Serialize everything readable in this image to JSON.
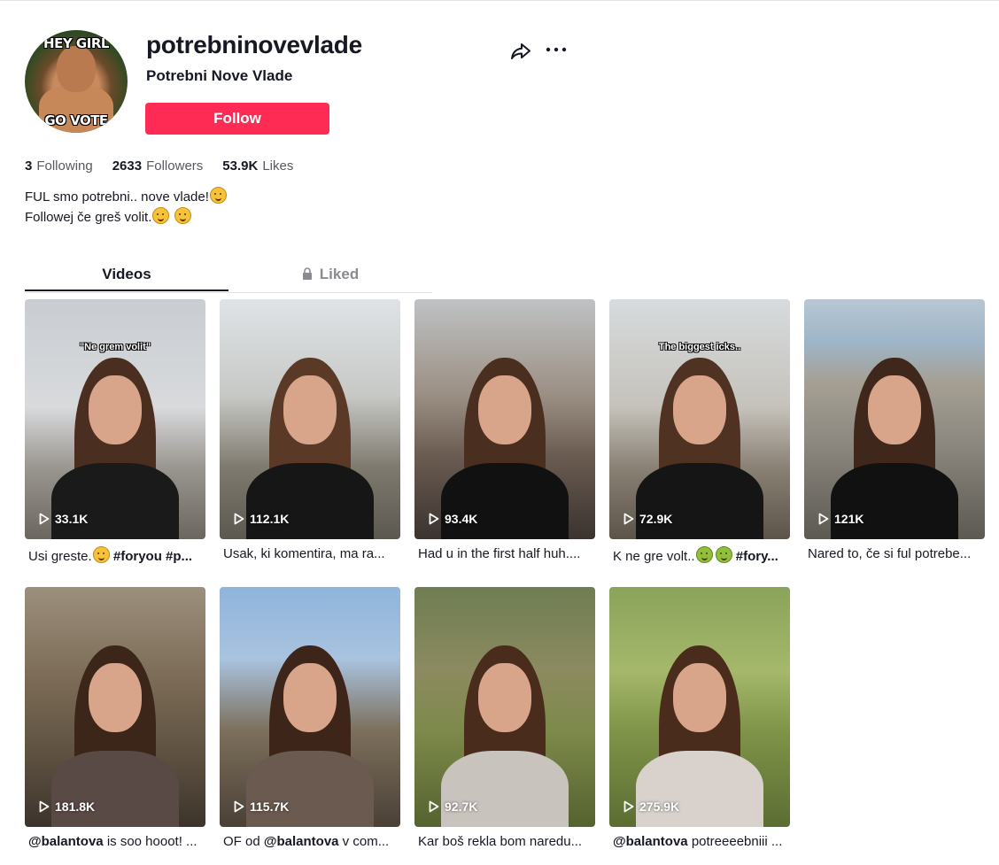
{
  "profile": {
    "avatar_text_top": "HEY GIRL",
    "avatar_text_bottom": "GO VOTE",
    "username": "potrebninovevlade",
    "display_name": "Potrebni Nove Vlade",
    "follow_label": "Follow",
    "stats": {
      "following_count": "3",
      "following_label": "Following",
      "followers_count": "2633",
      "followers_label": "Followers",
      "likes_count": "53.9K",
      "likes_label": "Likes"
    },
    "bio_line1": "FUL smo potrebni.. nove vlade!",
    "bio_line2": "Followej če greš volit."
  },
  "tabs": {
    "videos": "Videos",
    "liked": "Liked"
  },
  "colors": {
    "brand": "#fe2c55",
    "text": "#161823",
    "muted": "#58595f"
  },
  "videos": [
    {
      "views": "33.1K",
      "overlay": "\"Ne grem volit\"",
      "caption_pre": "Usi greste.",
      "caption_post": " #foryou #p..."
    },
    {
      "views": "112.1K",
      "overlay": "",
      "caption_pre": "Usak, ki komentira, ma ra...",
      "caption_post": ""
    },
    {
      "views": "93.4K",
      "overlay": "",
      "caption_pre": "Had u in the first half huh....",
      "caption_post": ""
    },
    {
      "views": "72.9K",
      "overlay": "The biggest icks..",
      "caption_pre": "K ne gre volt..",
      "caption_post": " #fory..."
    },
    {
      "views": "121K",
      "overlay": "",
      "caption_pre": "Nared to, če si ful potrebe...",
      "caption_post": ""
    },
    {
      "views": "181.8K",
      "overlay": "",
      "caption_mention": "@balantova",
      "caption_post": " is soo hooot! ..."
    },
    {
      "views": "115.7K",
      "overlay": "",
      "caption_pre": "OF od ",
      "caption_mention": "@balantova",
      "caption_post": " v com..."
    },
    {
      "views": "92.7K",
      "overlay": "",
      "caption_pre": "Kar boš rekla bom naredu...",
      "caption_post": ""
    },
    {
      "views": "275.9K",
      "overlay": "",
      "caption_mention": "@balantova",
      "caption_post": " potreeeebniii ..."
    }
  ]
}
